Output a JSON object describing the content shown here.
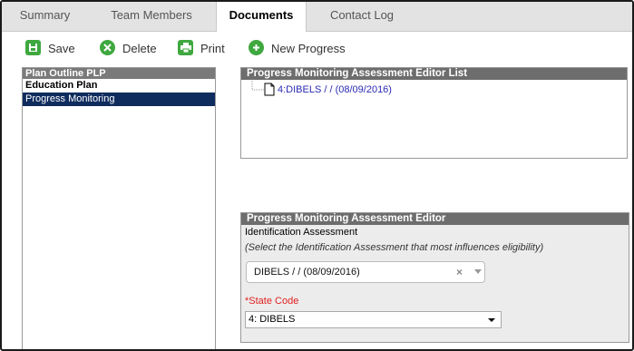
{
  "tabs": [
    {
      "label": "Summary",
      "active": false
    },
    {
      "label": "Team Members",
      "active": false
    },
    {
      "label": "Documents",
      "active": true
    },
    {
      "label": "Contact Log",
      "active": false
    }
  ],
  "toolbar": {
    "save_label": "Save",
    "delete_label": "Delete",
    "print_label": "Print",
    "new_progress_label": "New Progress"
  },
  "plan_outline": {
    "header": "Plan Outline PLP",
    "items": [
      {
        "label": "Education Plan",
        "bold": true,
        "selected": false
      },
      {
        "label": "Progress Monitoring",
        "bold": false,
        "selected": true
      }
    ]
  },
  "editor_list": {
    "header": "Progress Monitoring Assessment Editor List",
    "items": [
      {
        "label": "4:DIBELS / / (08/09/2016)"
      }
    ]
  },
  "editor": {
    "header": "Progress Monitoring Assessment Editor",
    "identification_label": "Identification Assessment",
    "identification_hint": "(Select the Identification Assessment that most influences eligibility)",
    "identification_value": "DIBELS / / (08/09/2016)",
    "state_code_required_mark": "*",
    "state_code_label": "State Code",
    "state_code_value": "4: DIBELS"
  },
  "colors": {
    "tab_bar": "#e3e3e3",
    "panel_header": "#6d6d6d",
    "selected_row": "#0f2c5e",
    "link": "#2a2ab5",
    "required": "#e21f1f",
    "icon_green": "#3fa83f",
    "editor_bg": "#ececec"
  }
}
